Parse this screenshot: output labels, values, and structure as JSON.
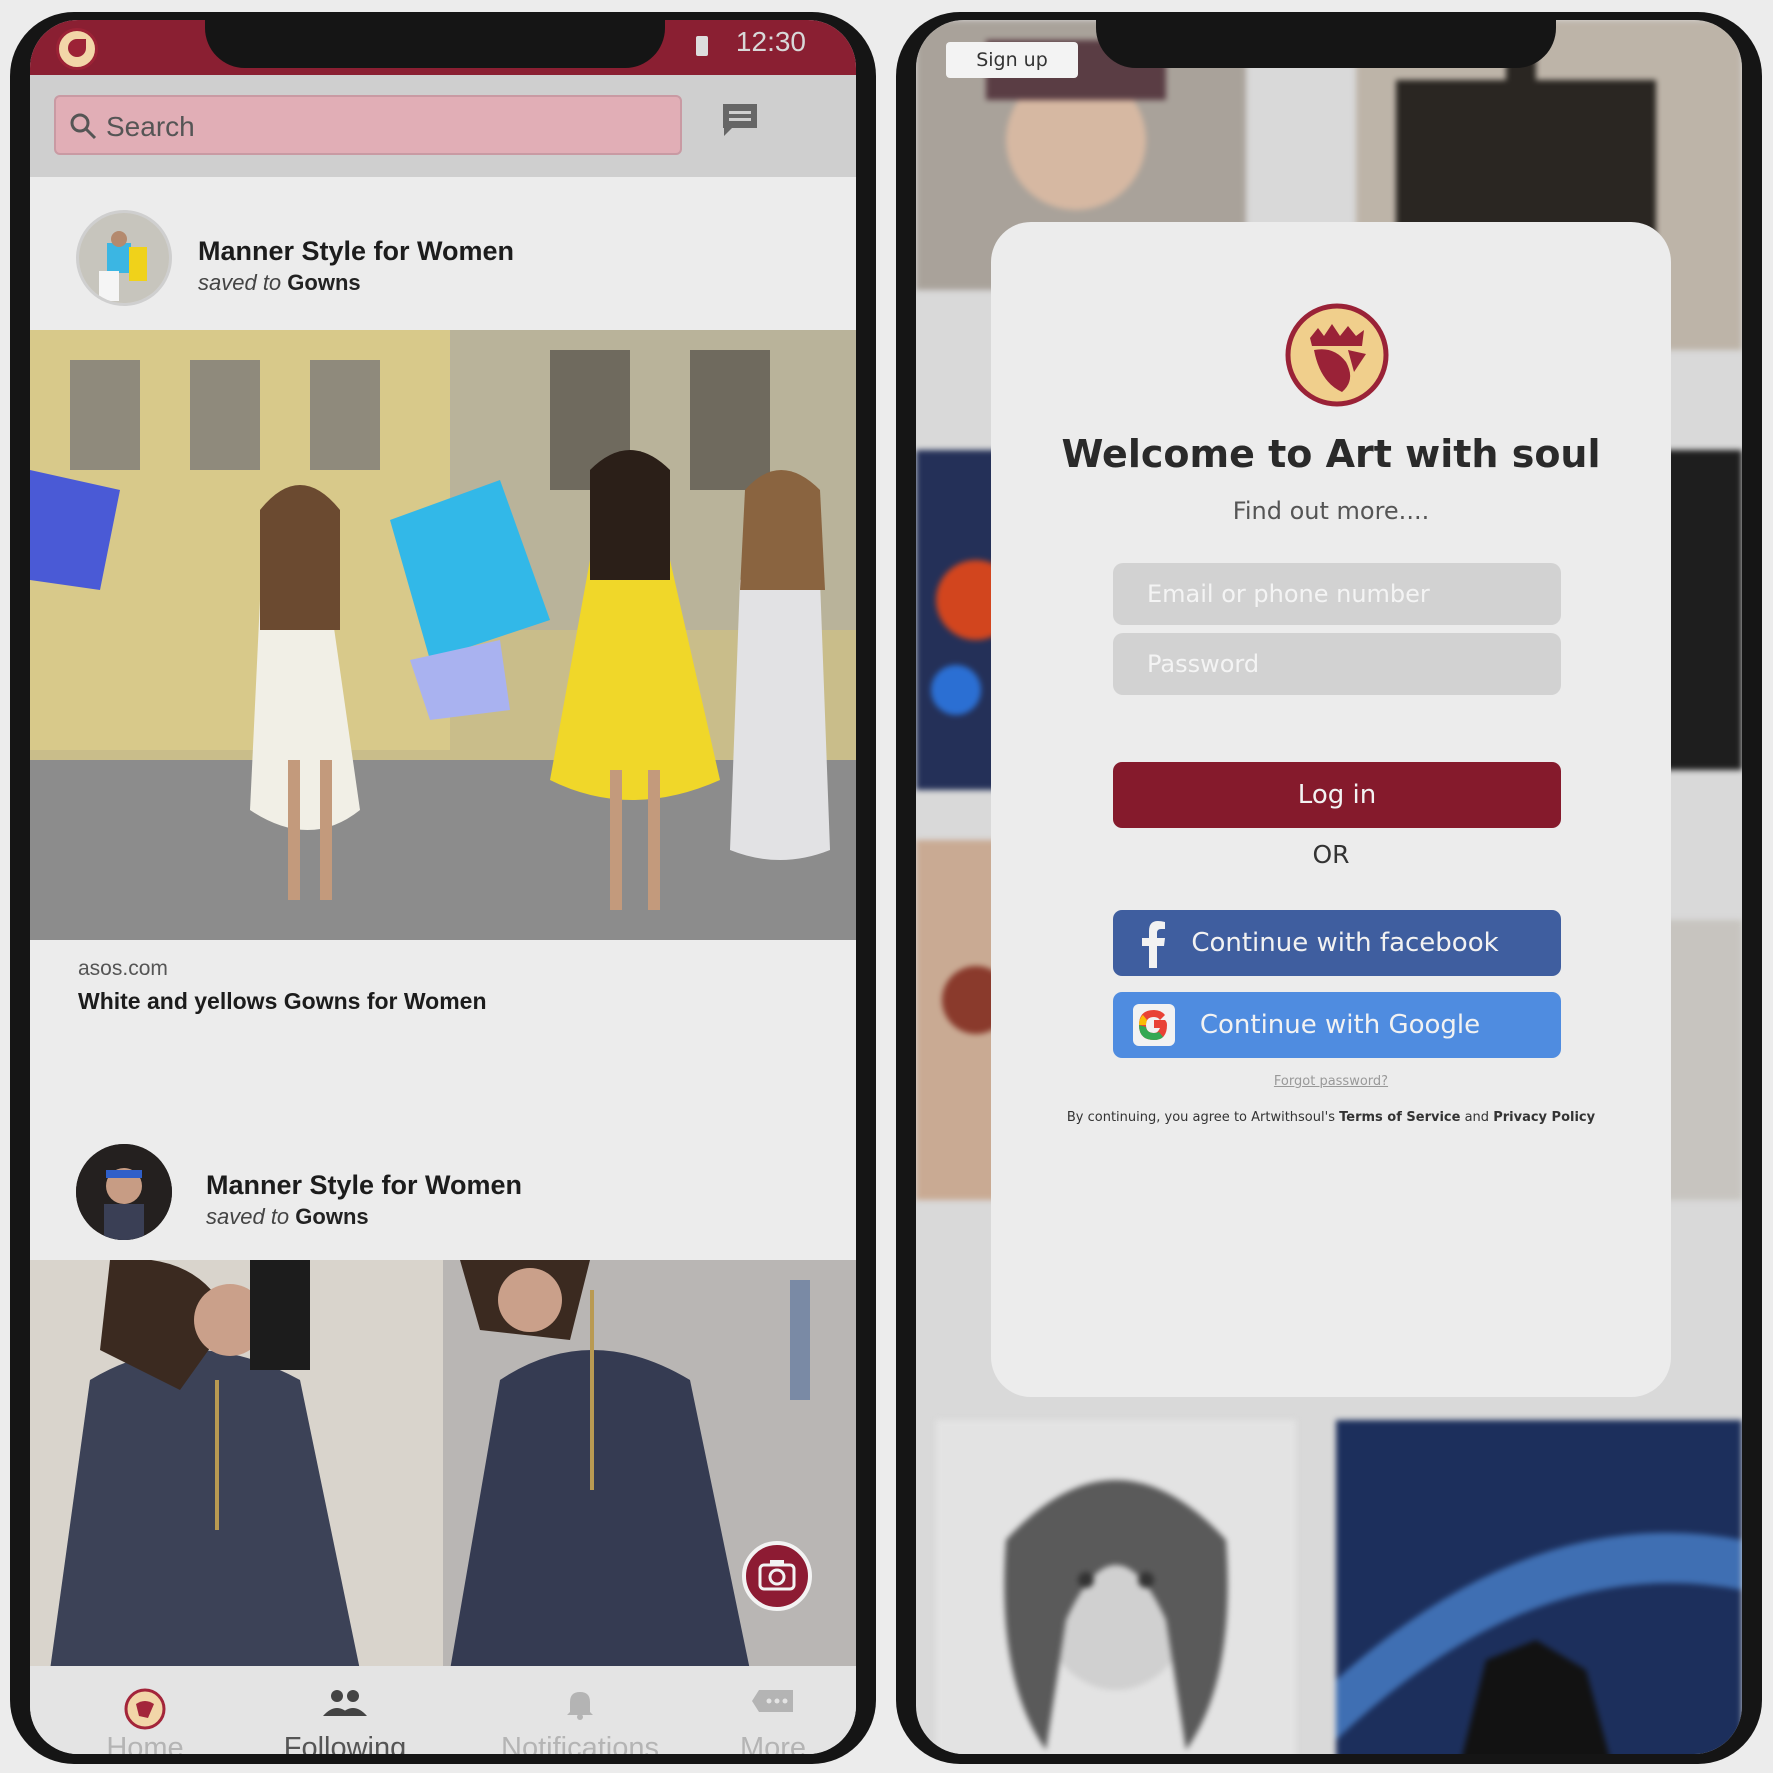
{
  "home_screen": {
    "status": {
      "time": "12:30"
    },
    "search": {
      "placeholder": "Search"
    },
    "posts": [
      {
        "author": "Manner Style for Women",
        "saved_prefix": "saved to",
        "board": "Gowns",
        "domain": "asos.com",
        "description": "White and yellows Gowns for Women"
      },
      {
        "author": "Manner Style for Women",
        "saved_prefix": "saved to",
        "board": "Gowns"
      }
    ],
    "nav": [
      {
        "label": "Home",
        "icon": "home-logo-icon",
        "active": false
      },
      {
        "label": "Following",
        "icon": "people-icon",
        "active": true
      },
      {
        "label": "Notifications",
        "icon": "bell-icon",
        "active": false
      },
      {
        "label": "More",
        "icon": "more-icon",
        "active": false
      }
    ]
  },
  "login_screen": {
    "signup_label": "Sign up",
    "title": "Welcome to Art with soul",
    "subtitle": "Find out more....",
    "email_placeholder": "Email or phone number",
    "password_placeholder": "Password",
    "login_label": "Log in",
    "or_label": "OR",
    "facebook_label": "Continue with facebook",
    "google_label": "Continue with Google",
    "forgot_label": "Forgot password?",
    "terms_prefix": "By continuing, you agree to Artwithsoul's",
    "terms_link": "Terms of Service",
    "terms_and": "and",
    "privacy_link": "Privacy Policy"
  },
  "colors": {
    "brand_maroon": "#8a1f32",
    "search_pink": "#e1aeb6",
    "facebook_blue": "#3f5e9f",
    "google_blue": "#4f8ce0"
  }
}
